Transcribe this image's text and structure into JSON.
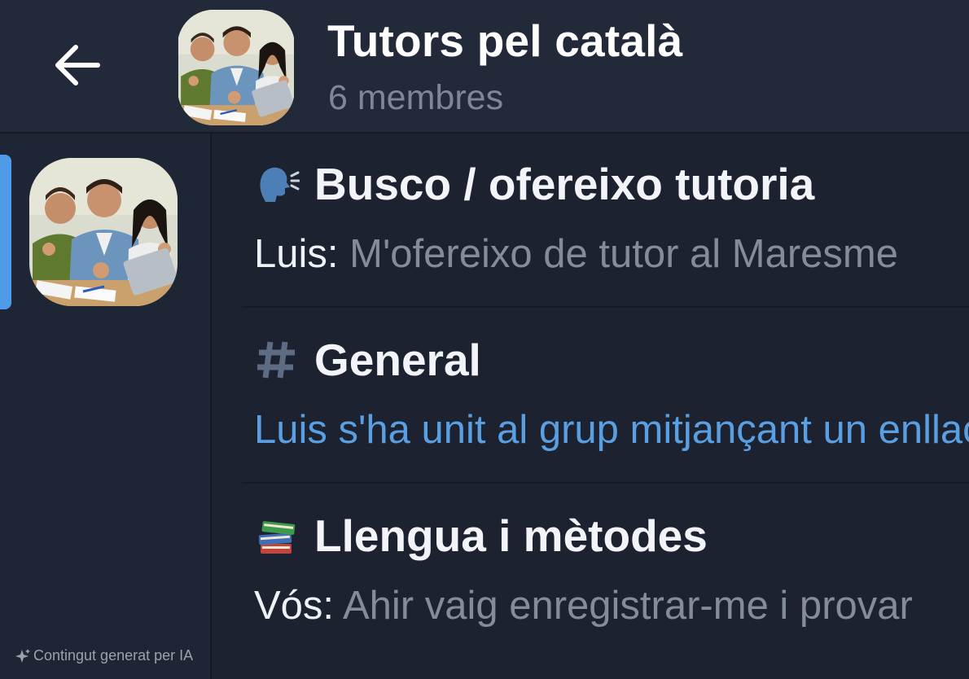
{
  "header": {
    "title": "Tutors pel català",
    "subtitle": "6 membres",
    "back_icon": "arrow-left-icon"
  },
  "sidebar": {
    "ai_note": "Contingut generat per IA",
    "ai_note_icon": "sparkle-icon"
  },
  "topics": [
    {
      "icon": "speaking-head-emoji",
      "name": "Busco / ofereixo tutoria",
      "sender": "Luis:",
      "message": " M'ofereixo de tutor al Maresme"
    },
    {
      "icon": "hash-icon",
      "name": "General",
      "system_message": "Luis s'ha unit al grup mitjançant un enllaç"
    },
    {
      "icon": "books-emoji",
      "name": "Llengua i mètodes",
      "sender": "Vós:",
      "message": " Ahir vaig enregistrar-me i provar"
    }
  ],
  "colors": {
    "background": "#1c2230",
    "header": "#222a3a",
    "accent": "#4f9be8",
    "system_text": "#5a9fe2",
    "muted_text": "#838c9b"
  }
}
